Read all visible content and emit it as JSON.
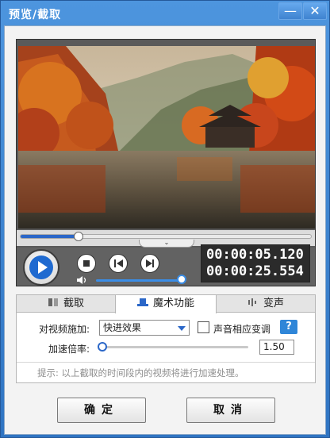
{
  "window": {
    "title": "预览/截取",
    "minimize_symbol": "—",
    "close_symbol": "✕"
  },
  "player": {
    "current_time": "00:00:05.120",
    "total_time": "00:00:25.554",
    "progress_fraction": 0.2,
    "volume_fraction": 1.0
  },
  "tabs": [
    {
      "label": "截取",
      "icon": "film-cut-icon"
    },
    {
      "label": "魔术功能",
      "icon": "magic-hat-icon",
      "selected": true
    },
    {
      "label": "变声",
      "icon": "audio-wave-icon"
    }
  ],
  "magic": {
    "apply_label": "对视频施加:",
    "effect_value": "快进效果",
    "pitch_label": "声音相应变调",
    "pitch_checked": false,
    "help_label": "?",
    "speed_label": "加速倍率:",
    "speed_value": "1.50",
    "hint": "提示: 以上截取的时间段内的视频将进行加速处理。"
  },
  "buttons": {
    "ok": "确定",
    "cancel": "取消"
  },
  "colors": {
    "title_bar": "#3a7ec6",
    "accent": "#2b67c8",
    "help": "#2f86d8"
  }
}
